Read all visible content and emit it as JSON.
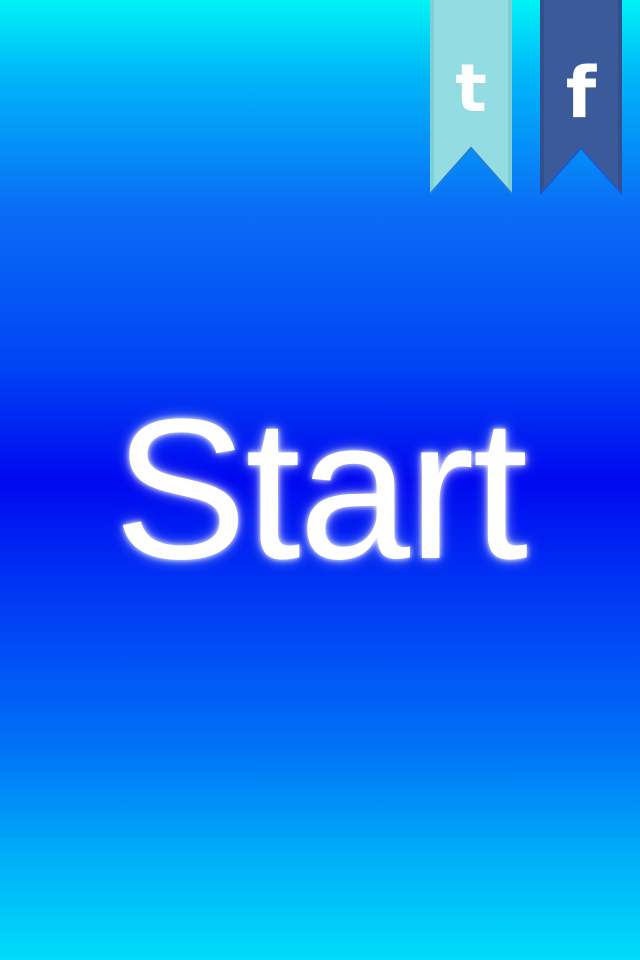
{
  "screen": {
    "background_top": "#00f3f6",
    "background_middle": "#0008f0",
    "background_bottom": "#00dcfa"
  },
  "social": {
    "twitter": {
      "icon": "twitter-icon",
      "glyph": "t",
      "color": "#93dce2",
      "edge_color": "#6cc3cc"
    },
    "facebook": {
      "icon": "facebook-icon",
      "glyph": "f",
      "color": "#3b5a9a",
      "edge_color": "#2c4680"
    }
  },
  "start": {
    "label": "Start",
    "color": "#ffffff"
  }
}
